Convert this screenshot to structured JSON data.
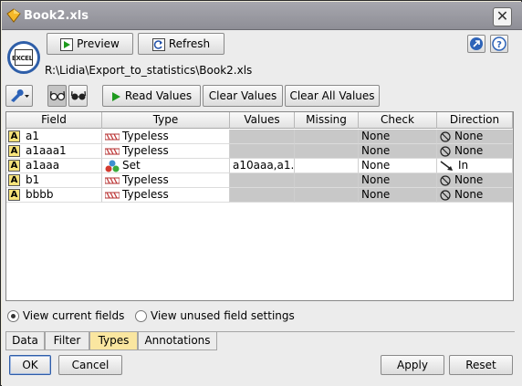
{
  "window": {
    "title": "Book2.xls",
    "close_glyph": "✕"
  },
  "node_icon": {
    "label": "EXCEL",
    "icon": "excel-source-icon"
  },
  "toolbar": {
    "preview_label": "Preview",
    "refresh_label": "Refresh"
  },
  "file_path": "R:\\Lidia\\Export_to_statistics\\Book2.xls",
  "types_toolbar": {
    "read_values_label": "Read Values",
    "clear_values_label": "Clear Values",
    "clear_all_values_label": "Clear All Values"
  },
  "table": {
    "columns": [
      "Field",
      "Type",
      "Values",
      "Missing",
      "Check",
      "Direction"
    ],
    "rows": [
      {
        "field": "a1",
        "type": "Typeless",
        "values": "",
        "missing": "",
        "check": "None",
        "direction": "None",
        "type_icon": "typeless-icon",
        "direction_icon": "none-icon"
      },
      {
        "field": "a1aaa1",
        "type": "Typeless",
        "values": "",
        "missing": "",
        "check": "None",
        "direction": "None",
        "type_icon": "typeless-icon",
        "direction_icon": "none-icon"
      },
      {
        "field": "a1aaa",
        "type": "Set",
        "values": "a10aaa,a1...",
        "missing": "",
        "check": "None",
        "direction": "In",
        "type_icon": "set-icon",
        "direction_icon": "in-arrow-icon"
      },
      {
        "field": "b1",
        "type": "Typeless",
        "values": "",
        "missing": "",
        "check": "None",
        "direction": "None",
        "type_icon": "typeless-icon",
        "direction_icon": "none-icon"
      },
      {
        "field": "bbbb",
        "type": "Typeless",
        "values": "",
        "missing": "",
        "check": "None",
        "direction": "None",
        "type_icon": "typeless-icon",
        "direction_icon": "none-icon"
      }
    ]
  },
  "view_options": {
    "current_label": "View current fields",
    "unused_label": "View unused field settings",
    "selected": "current"
  },
  "tabs": [
    "Data",
    "Filter",
    "Types",
    "Annotations"
  ],
  "active_tab": "Types",
  "footer": {
    "ok_label": "OK",
    "cancel_label": "Cancel",
    "apply_label": "Apply",
    "reset_label": "Reset"
  },
  "colors": {
    "titlebar": "#9b9ba2",
    "active_tab": "#fae6a0",
    "grid_gray": "#c8c8c8"
  }
}
